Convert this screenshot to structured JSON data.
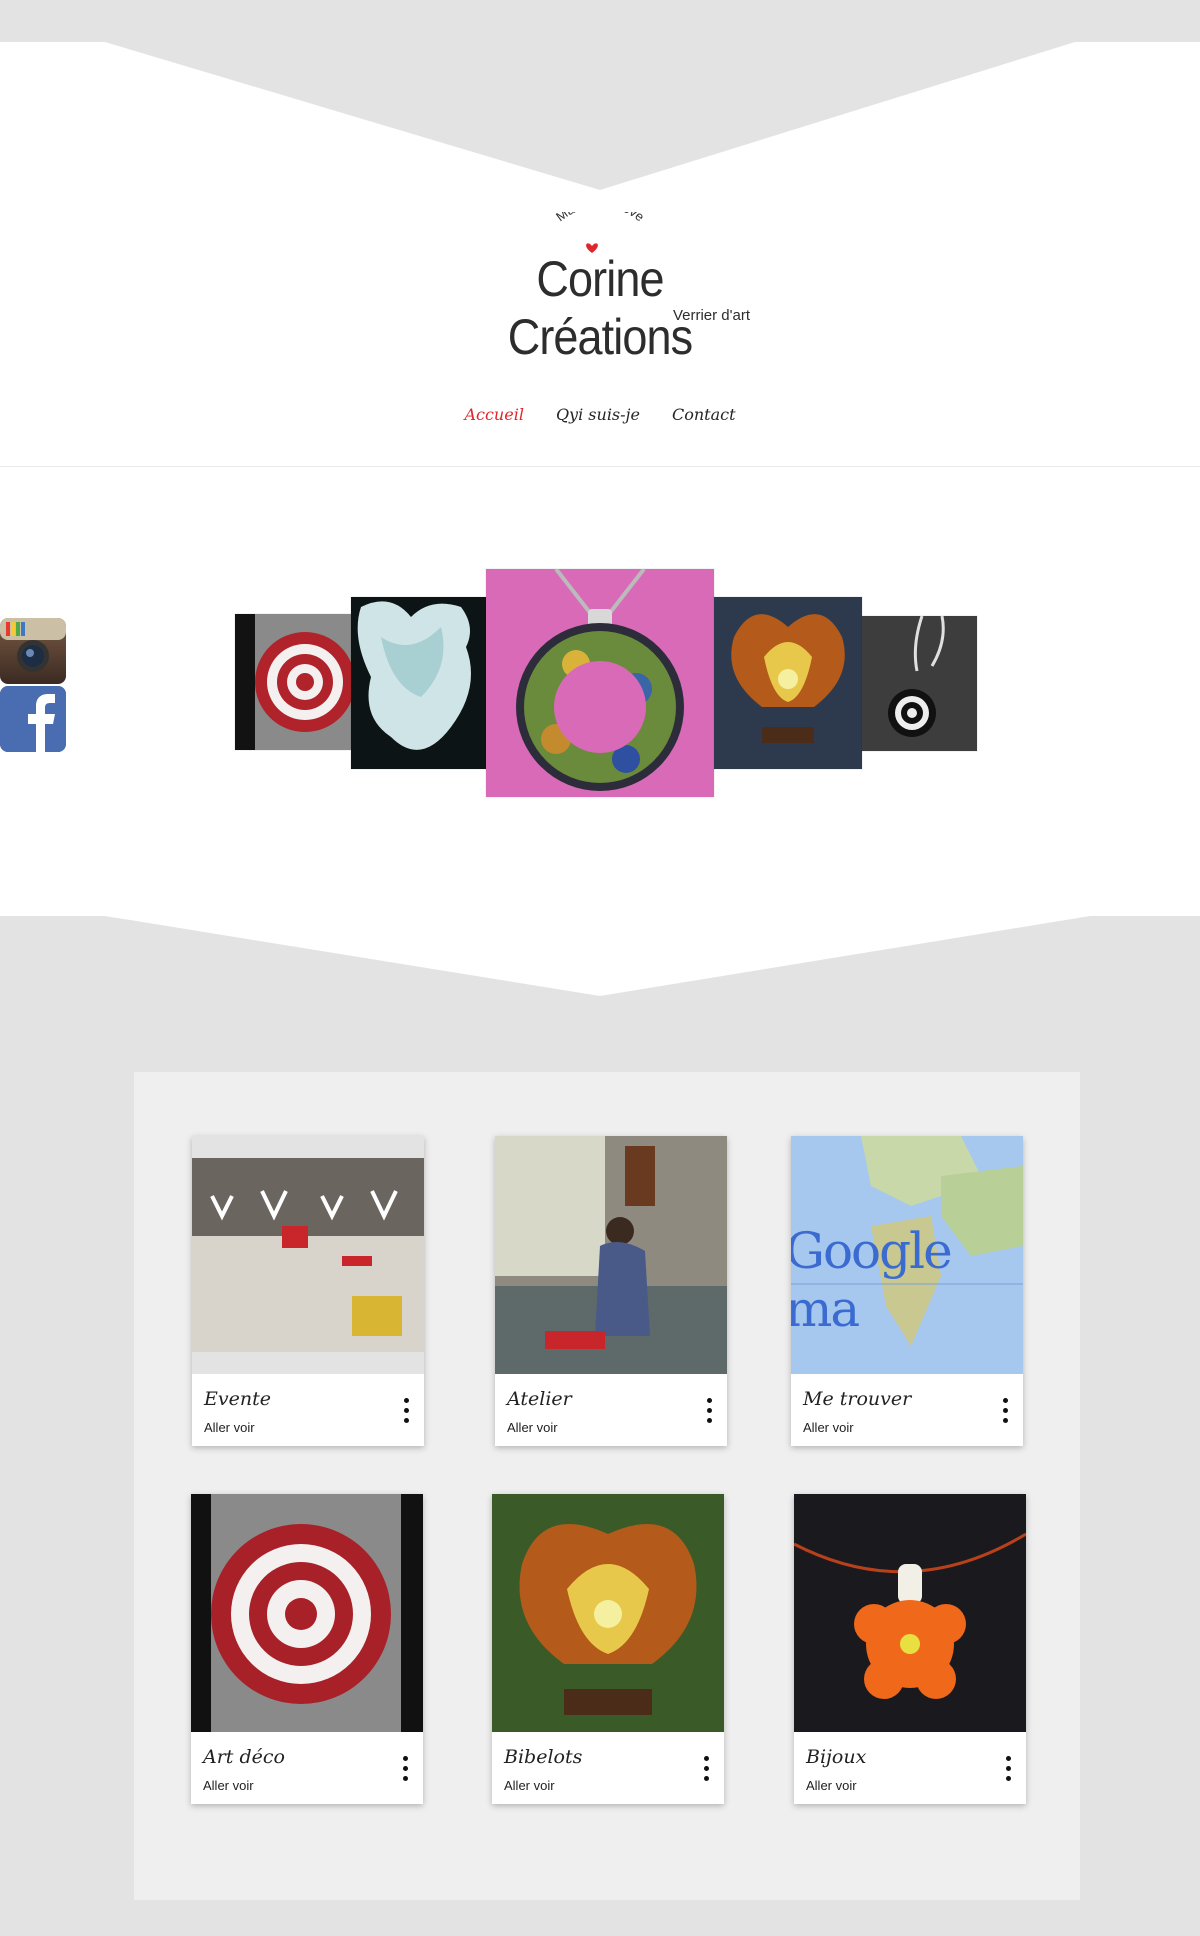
{
  "logo": {
    "tagline": "Made with love",
    "name": "Corine Créations",
    "subtitle": "Verrier d'art"
  },
  "nav": [
    {
      "label": "Accueil",
      "active": true
    },
    {
      "label": "Qyi suis-je",
      "active": false
    },
    {
      "label": "Contact",
      "active": false
    }
  ],
  "social": [
    {
      "icon": "instagram-icon"
    },
    {
      "icon": "facebook-icon"
    }
  ],
  "cards": [
    {
      "title": "Evente",
      "link": "Aller voir"
    },
    {
      "title": "Atelier",
      "link": "Aller voir"
    },
    {
      "title": "Me trouver",
      "link": "Aller voir"
    },
    {
      "title": "Art déco",
      "link": "Aller voir"
    },
    {
      "title": "Bibelots",
      "link": "Aller voir"
    },
    {
      "title": "Bijoux",
      "link": "Aller voir"
    }
  ],
  "map_text": "Google ma",
  "colors": {
    "accent": "#e0252b",
    "header_bg": "#e4e3e4",
    "panel_bg": "#efefef"
  }
}
